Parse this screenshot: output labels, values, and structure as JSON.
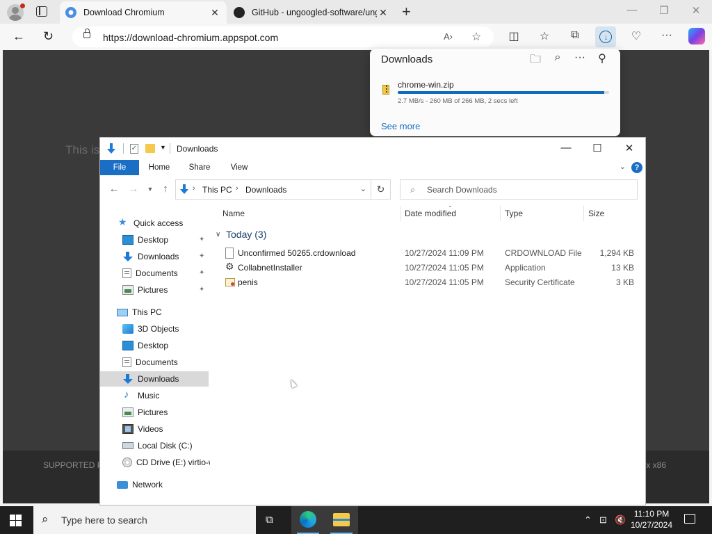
{
  "browser": {
    "tabs": [
      {
        "title": "Download Chromium"
      },
      {
        "title": "GitHub - ungoogled-software/ungoogled-chromium"
      }
    ],
    "url": "https://download-chromium.appspot.com",
    "icons": [
      "profile-icon",
      "tab-actions-icon",
      "back-icon",
      "refresh-icon",
      "lock-icon",
      "read-aloud-icon",
      "favorite-icon",
      "split-screen-icon",
      "favorites-icon",
      "collections-icon",
      "downloads-icon",
      "browser-essentials-icon",
      "more-icon",
      "copilot-icon"
    ]
  },
  "page": {
    "text": "This is",
    "footer_left": "SUPPORTED PL",
    "footer_right": "x x86"
  },
  "downloads_panel": {
    "title": "Downloads",
    "file_name": "chrome-win.zip",
    "progress": 0.977,
    "status": "2.7 MB/s - 260 MB of 266 MB, 2 secs left",
    "see_more": "See more"
  },
  "explorer": {
    "title": "Downloads",
    "ribbon_tabs": [
      "File",
      "Home",
      "Share",
      "View"
    ],
    "breadcrumb": [
      "This PC",
      "Downloads"
    ],
    "search_placeholder": "Search Downloads",
    "nav": {
      "quick_access": "Quick access",
      "quick_items": [
        "Desktop",
        "Downloads",
        "Documents",
        "Pictures"
      ],
      "this_pc": "This PC",
      "pc_items": [
        "3D Objects",
        "Desktop",
        "Documents",
        "Downloads",
        "Music",
        "Pictures",
        "Videos",
        "Local Disk (C:)",
        "CD Drive (E:) virtio-w"
      ],
      "network": "Network"
    },
    "columns": [
      "Name",
      "Date modified",
      "Type",
      "Size"
    ],
    "group": "Today (3)",
    "files": [
      {
        "name": "Unconfirmed 50265.crdownload",
        "date": "10/27/2024 11:09 PM",
        "type": "CRDOWNLOAD File",
        "size": "1,294 KB"
      },
      {
        "name": "CollabnetInstaller",
        "date": "10/27/2024 11:05 PM",
        "type": "Application",
        "size": "13 KB"
      },
      {
        "name": "penis",
        "date": "10/27/2024 11:05 PM",
        "type": "Security Certificate",
        "size": "3 KB"
      }
    ]
  },
  "taskbar": {
    "search_text": "Type here to search",
    "time": "11:10 PM",
    "date": "10/27/2024"
  }
}
